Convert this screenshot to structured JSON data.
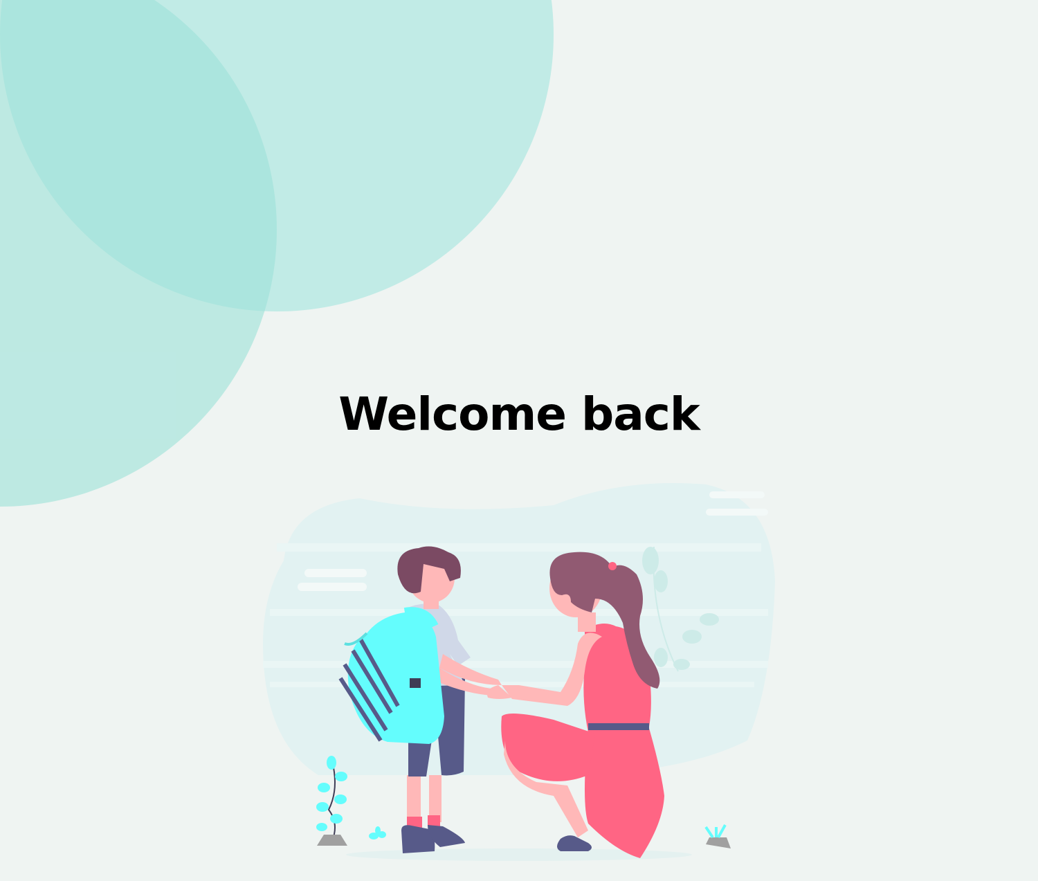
{
  "welcome": {
    "title": "Welcome back"
  },
  "illustration": {
    "icon": "parent-child-illustration",
    "description_role": "decorative"
  },
  "colors": {
    "background": "#eff4f2",
    "circle_light": "#c1ebe6",
    "circle_medium": "#9ee2d9",
    "accent_teal": "#64fdfd",
    "dress": "#ff6584",
    "hair_child": "#7b4a63",
    "hair_woman": "#915a72",
    "skin": "#ffb8b8",
    "shorts": "#575a89"
  }
}
